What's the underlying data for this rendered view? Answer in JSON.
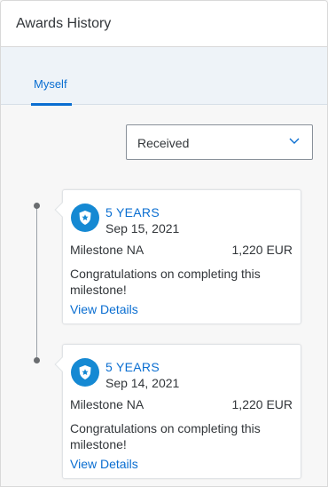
{
  "header": {
    "title": "Awards History"
  },
  "tabs": [
    {
      "label": "Myself",
      "selected": true
    }
  ],
  "filter": {
    "selected": "Received"
  },
  "awards": [
    {
      "years": "5 YEARS",
      "date": "Sep 15, 2021",
      "name": "Milestone NA",
      "amount": "1,220 EUR",
      "message": "Congratulations on completing this milestone!",
      "link": "View Details"
    },
    {
      "years": "5 YEARS",
      "date": "Sep 14, 2021",
      "name": "Milestone NA",
      "amount": "1,220 EUR",
      "message": "Congratulations on completing this milestone!",
      "link": "View Details"
    }
  ],
  "colors": {
    "accent": "#0a6ed1",
    "icon_bg": "#1589d3",
    "text": "#32363a"
  },
  "icons": {
    "award": "award-badge-icon",
    "dropdown": "chevron-down-icon"
  }
}
